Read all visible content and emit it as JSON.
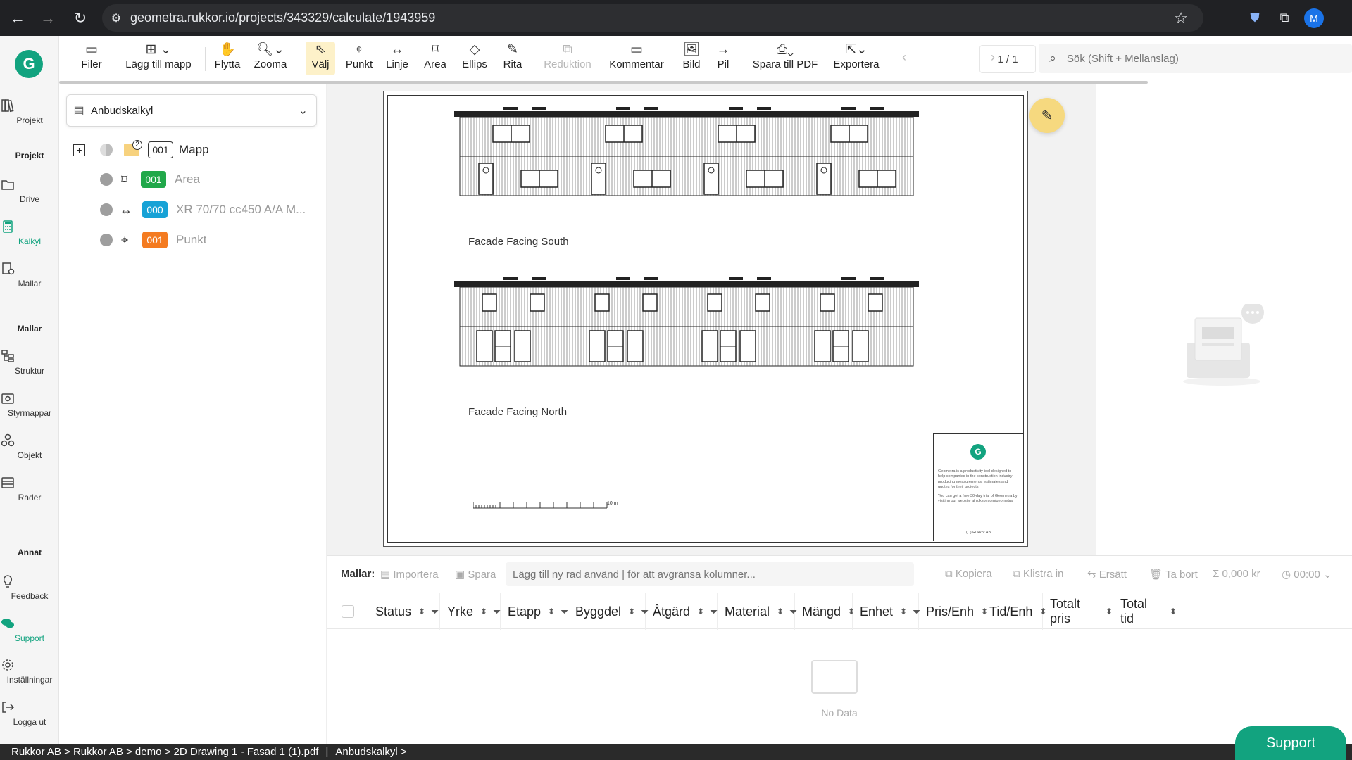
{
  "browser": {
    "url": "geometra.rukkor.io/projects/343329/calculate/1943959",
    "profile_initial": "M"
  },
  "sidebar": {
    "logo": "G",
    "sections": {
      "projekt": "Projekt",
      "mallar": "Mallar",
      "annat": "Annat"
    },
    "items": [
      {
        "label": "Projekt",
        "icon": "books-icon"
      },
      {
        "label": "Drive",
        "icon": "folder-icon"
      },
      {
        "label": "Kalkyl",
        "icon": "calculator-icon"
      },
      {
        "label": "Mallar",
        "icon": "template-icon"
      },
      {
        "label": "Struktur",
        "icon": "structure-icon"
      },
      {
        "label": "Styrmappar",
        "icon": "camera-folder-icon"
      },
      {
        "label": "Objekt",
        "icon": "objects-icon"
      },
      {
        "label": "Rader",
        "icon": "rows-icon"
      },
      {
        "label": "Feedback",
        "icon": "lightbulb-icon"
      },
      {
        "label": "Support",
        "icon": "chat-icon"
      },
      {
        "label": "Inställningar",
        "icon": "gear-icon"
      },
      {
        "label": "Logga ut",
        "icon": "logout-icon"
      }
    ]
  },
  "toolbar": {
    "tools": [
      {
        "label": "Filer",
        "icon": "files-icon"
      },
      {
        "label": "Lägg till mapp",
        "icon": "add-folder-icon"
      },
      {
        "label": "Flytta",
        "icon": "hand-icon"
      },
      {
        "label": "Zooma",
        "icon": "zoom-icon"
      },
      {
        "label": "Välj",
        "icon": "cursor-icon"
      },
      {
        "label": "Punkt",
        "icon": "crosshair-icon"
      },
      {
        "label": "Linje",
        "icon": "line-icon"
      },
      {
        "label": "Area",
        "icon": "area-icon"
      },
      {
        "label": "Ellips",
        "icon": "ellipse-icon"
      },
      {
        "label": "Rita",
        "icon": "draw-icon"
      },
      {
        "label": "Reduktion",
        "icon": "reduction-icon"
      },
      {
        "label": "Kommentar",
        "icon": "comment-icon"
      },
      {
        "label": "Bild",
        "icon": "image-icon"
      },
      {
        "label": "Pil",
        "icon": "arrow-icon"
      },
      {
        "label": "Spara till PDF",
        "icon": "printer-icon"
      },
      {
        "label": "Exportera",
        "icon": "export-icon"
      }
    ],
    "page_indicator": "1 / 1",
    "search_placeholder": "Sök (Shift + Mellanslag)"
  },
  "tree": {
    "calculation": "Anbudskalkyl",
    "folder_badge": "2",
    "rows": [
      {
        "code": "001",
        "label": "Mapp"
      },
      {
        "code": "001",
        "label": "Area"
      },
      {
        "code": "000",
        "label": "XR 70/70 cc450 A/A M..."
      },
      {
        "code": "001",
        "label": "Punkt"
      }
    ]
  },
  "drawing": {
    "labels": {
      "south": "Facade Facing South",
      "north": "Facade Facing North"
    },
    "scale_label": "10 m",
    "title_block": {
      "logo": "G",
      "text": "Geometra is a productivity tool designed to help companies in the construction industry producing measurements, estimates and quotes for their projects.",
      "trial": "You can get a free 30-day trial of Geometra by visiting our website at rukkor.com/geometra",
      "copyright": "(C) Rukkor AB"
    }
  },
  "table": {
    "mallar_label": "Mallar:",
    "actions": {
      "importera": "Importera",
      "spara": "Spara",
      "kopiera": "Kopiera",
      "klistra": "Klistra in",
      "ersatt": "Ersätt",
      "tabort": "Ta bort",
      "total_price": "0,000 kr",
      "total_time": "00:00"
    },
    "row_input_placeholder": "Lägg till ny rad använd | för att avgränsa kolumner...",
    "columns": [
      "Status",
      "Yrke",
      "Etapp",
      "Byggdel",
      "Åtgärd",
      "Material",
      "Mängd",
      "Enhet",
      "Pris/Enh",
      "Tid/Enh",
      "Totalt pris",
      "Total tid"
    ],
    "empty_text": "No Data"
  },
  "statusbar": {
    "breadcrumb": "Rukkor AB > Rukkor AB > demo > 2D Drawing 1 - Fasad 1 (1).pdf",
    "calc": "Anbudskalkyl >"
  },
  "support_label": "Support",
  "colors": {
    "brand": "#12a37f",
    "selected_tool": "#fdf1c9",
    "badge_green": "#21a84a",
    "badge_blue": "#17a2d6",
    "badge_orange": "#f47b20"
  }
}
